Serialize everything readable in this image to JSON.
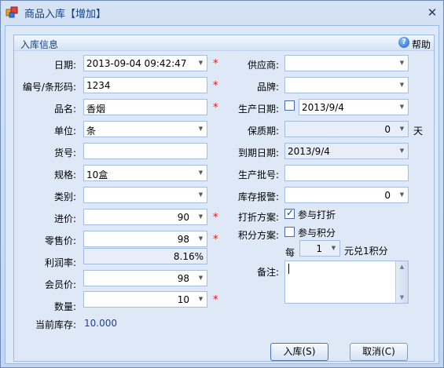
{
  "window": {
    "title": "商品入库【增加】",
    "close_symbol": "✕"
  },
  "group": {
    "title": "入库信息",
    "help_label": "帮助"
  },
  "left": {
    "date": {
      "label": "日期:",
      "value": "2013-09-04 09:42:47"
    },
    "code": {
      "label": "编号/条形码:",
      "value": "1234"
    },
    "name": {
      "label": "品名:",
      "value": "香烟"
    },
    "unit": {
      "label": "单位:",
      "value": "条"
    },
    "shelf": {
      "label": "货号:",
      "value": ""
    },
    "spec": {
      "label": "规格:",
      "value": "10盒"
    },
    "category": {
      "label": "类别:",
      "value": ""
    },
    "purchase_price": {
      "label": "进价:",
      "value": "90"
    },
    "retail_price": {
      "label": "零售价:",
      "value": "98"
    },
    "profit_rate": {
      "label": "利润率:",
      "value": "8.16%"
    },
    "member_price": {
      "label": "会员价:",
      "value": "98"
    },
    "quantity": {
      "label": "数量:",
      "value": "10"
    },
    "current_stock": {
      "label": "当前库存:",
      "value": "10.000"
    }
  },
  "right": {
    "supplier": {
      "label": "供应商:",
      "value": ""
    },
    "brand": {
      "label": "品牌:",
      "value": ""
    },
    "production_date": {
      "label": "生产日期:",
      "value": "2013/9/4"
    },
    "shelf_life": {
      "label": "保质期:",
      "value": "0",
      "unit": "天"
    },
    "expiry_date": {
      "label": "到期日期:",
      "value": "2013/9/4"
    },
    "batch_no": {
      "label": "生产批号:",
      "value": ""
    },
    "stock_alert": {
      "label": "库存报警:",
      "value": "0"
    },
    "discount_plan": {
      "label": "打折方案:",
      "option": "参与打折",
      "checked": true
    },
    "points_plan": {
      "label": "积分方案:",
      "option": "参与积分",
      "checked": false
    },
    "points_rule": {
      "prefix": "每",
      "value": "1",
      "suffix": "元兑1积分"
    },
    "remark": {
      "label": "备注:",
      "value": ""
    }
  },
  "required_mark": "*",
  "buttons": {
    "submit": "入库(S)",
    "cancel": "取消(C)"
  }
}
